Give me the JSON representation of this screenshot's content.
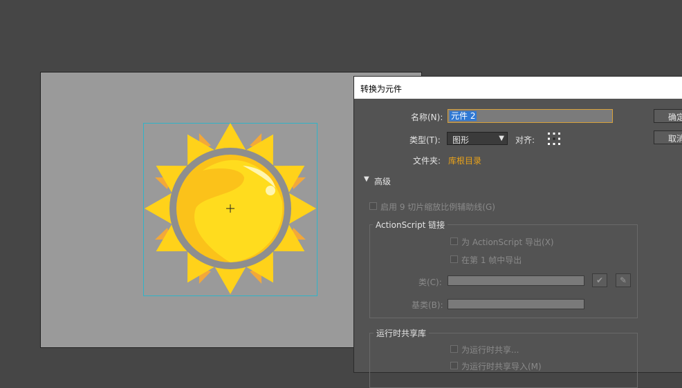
{
  "dialog": {
    "title": "转换为元件",
    "name_label": "名称(N):",
    "name_value": "元件 2",
    "type_label": "类型(T):",
    "type_value": "图形",
    "align_label": "对齐:",
    "folder_label": "文件夹:",
    "folder_value": "库根目录",
    "ok_label": "确定",
    "cancel_label": "取消",
    "advanced_label": "高级",
    "enable_9slice_label": "启用 9 切片缩放比例辅助线(G)",
    "actionscript_group_label": "ActionScript 链接",
    "export_as_label": "为 ActionScript 导出(X)",
    "export_frame1_label": "在第 1 帧中导出",
    "class_label": "类(C):",
    "base_class_label": "基类(B):",
    "runtime_group_label": "运行时共享库",
    "runtime_export_label": "为运行时共享...",
    "runtime_import_label": "为运行时共享导入(M)"
  },
  "colors": {
    "accent_folder": "#e8a21a",
    "selection_box": "#2fb4c8",
    "sun_yellow": "#ffd21a",
    "sun_orange": "#f2a83a",
    "sun_ring": "#8e8e8e"
  }
}
